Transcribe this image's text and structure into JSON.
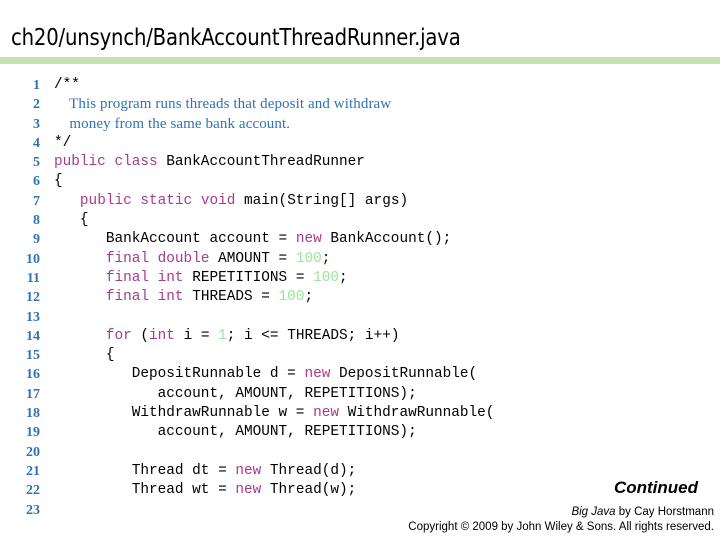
{
  "slide": {
    "title": "ch20/unsynch/BankAccountThreadRunner.java",
    "rule_color": "#c8e3ae"
  },
  "colors": {
    "line_number": "#2e74b5",
    "comment": "#2e74b5",
    "keyword": "#a83b8c",
    "number_literal": "#99e699",
    "plain": "#000000"
  },
  "code": {
    "lines": [
      {
        "n": "1",
        "kind": "code",
        "tokens": [
          {
            "t": "/**",
            "c": "plain"
          }
        ]
      },
      {
        "n": "2",
        "kind": "comment",
        "tokens": [
          {
            "t": "    This program runs threads that deposit and withdraw",
            "c": "comment"
          }
        ]
      },
      {
        "n": "3",
        "kind": "comment",
        "tokens": [
          {
            "t": "    money from the same bank account.",
            "c": "comment"
          }
        ]
      },
      {
        "n": "4",
        "kind": "code",
        "tokens": [
          {
            "t": "*/",
            "c": "plain"
          }
        ]
      },
      {
        "n": "5",
        "kind": "code",
        "tokens": [
          {
            "t": "public class ",
            "c": "kw"
          },
          {
            "t": "BankAccountThreadRunner",
            "c": "plain"
          }
        ]
      },
      {
        "n": "6",
        "kind": "code",
        "tokens": [
          {
            "t": "{",
            "c": "plain"
          }
        ]
      },
      {
        "n": "7",
        "kind": "code",
        "tokens": [
          {
            "t": "   ",
            "c": "plain"
          },
          {
            "t": "public static void ",
            "c": "kw"
          },
          {
            "t": "main(String[] args)",
            "c": "plain"
          }
        ]
      },
      {
        "n": "8",
        "kind": "code",
        "tokens": [
          {
            "t": "   {",
            "c": "plain"
          }
        ]
      },
      {
        "n": "9",
        "kind": "code",
        "tokens": [
          {
            "t": "      BankAccount account = ",
            "c": "plain"
          },
          {
            "t": "new ",
            "c": "kw"
          },
          {
            "t": "BankAccount();",
            "c": "plain"
          }
        ]
      },
      {
        "n": "10",
        "kind": "code",
        "tokens": [
          {
            "t": "      ",
            "c": "plain"
          },
          {
            "t": "final double ",
            "c": "kw"
          },
          {
            "t": "AMOUNT = ",
            "c": "plain"
          },
          {
            "t": "100",
            "c": "num"
          },
          {
            "t": ";",
            "c": "plain"
          }
        ]
      },
      {
        "n": "11",
        "kind": "code",
        "tokens": [
          {
            "t": "      ",
            "c": "plain"
          },
          {
            "t": "final int ",
            "c": "kw"
          },
          {
            "t": "REPETITIONS = ",
            "c": "plain"
          },
          {
            "t": "100",
            "c": "num"
          },
          {
            "t": ";",
            "c": "plain"
          }
        ]
      },
      {
        "n": "12",
        "kind": "code",
        "tokens": [
          {
            "t": "      ",
            "c": "plain"
          },
          {
            "t": "final int ",
            "c": "kw"
          },
          {
            "t": "THREADS = ",
            "c": "plain"
          },
          {
            "t": "100",
            "c": "num"
          },
          {
            "t": ";",
            "c": "plain"
          }
        ]
      },
      {
        "n": "13",
        "kind": "code",
        "tokens": [
          {
            "t": "",
            "c": "plain"
          }
        ]
      },
      {
        "n": "14",
        "kind": "code",
        "tokens": [
          {
            "t": "      ",
            "c": "plain"
          },
          {
            "t": "for ",
            "c": "kw"
          },
          {
            "t": "(",
            "c": "plain"
          },
          {
            "t": "int ",
            "c": "kw"
          },
          {
            "t": "i = ",
            "c": "plain"
          },
          {
            "t": "1",
            "c": "num"
          },
          {
            "t": "; i <= THREADS; i++)",
            "c": "plain"
          }
        ]
      },
      {
        "n": "15",
        "kind": "code",
        "tokens": [
          {
            "t": "      {",
            "c": "plain"
          }
        ]
      },
      {
        "n": "16",
        "kind": "code",
        "tokens": [
          {
            "t": "         DepositRunnable d = ",
            "c": "plain"
          },
          {
            "t": "new ",
            "c": "kw"
          },
          {
            "t": "DepositRunnable(",
            "c": "plain"
          }
        ]
      },
      {
        "n": "17",
        "kind": "code",
        "tokens": [
          {
            "t": "            account, AMOUNT, REPETITIONS);",
            "c": "plain"
          }
        ]
      },
      {
        "n": "18",
        "kind": "code",
        "tokens": [
          {
            "t": "         WithdrawRunnable w = ",
            "c": "plain"
          },
          {
            "t": "new ",
            "c": "kw"
          },
          {
            "t": "WithdrawRunnable(",
            "c": "plain"
          }
        ]
      },
      {
        "n": "19",
        "kind": "code",
        "tokens": [
          {
            "t": "            account, AMOUNT, REPETITIONS);",
            "c": "plain"
          }
        ]
      },
      {
        "n": "20",
        "kind": "code",
        "tokens": [
          {
            "t": "",
            "c": "plain"
          }
        ]
      },
      {
        "n": "21",
        "kind": "code",
        "tokens": [
          {
            "t": "         Thread dt = ",
            "c": "plain"
          },
          {
            "t": "new ",
            "c": "kw"
          },
          {
            "t": "Thread(d);",
            "c": "plain"
          }
        ]
      },
      {
        "n": "22",
        "kind": "code",
        "tokens": [
          {
            "t": "         Thread wt = ",
            "c": "plain"
          },
          {
            "t": "new ",
            "c": "kw"
          },
          {
            "t": "Thread(w);",
            "c": "plain"
          }
        ]
      },
      {
        "n": "23",
        "kind": "code",
        "tokens": [
          {
            "t": "",
            "c": "plain"
          }
        ]
      }
    ]
  },
  "footer": {
    "continued": "Continued",
    "credit_book": "Big Java",
    "credit_rest": " by Cay Horstmann",
    "copyright": "Copyright © 2009 by John Wiley & Sons.  All rights reserved."
  }
}
